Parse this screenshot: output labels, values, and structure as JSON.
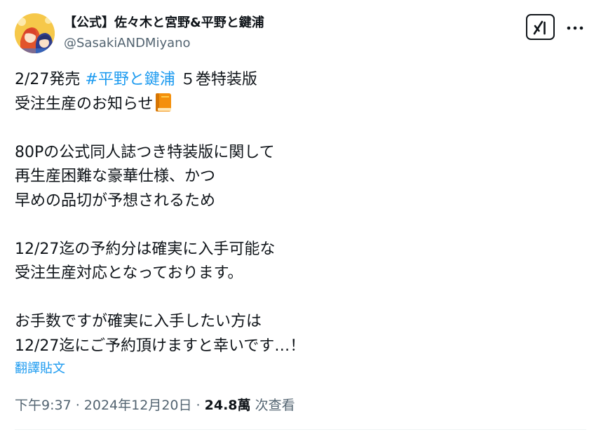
{
  "author": {
    "display_name": "【公式】佐々木と宮野&平野と鍵浦",
    "handle": "@SasakiANDMiyano",
    "avatar_icon": "anime-characters-avatar-icon"
  },
  "header_actions": {
    "grok_icon": "grok-icon",
    "more_icon": "more-horizontal-icon"
  },
  "post": {
    "line1_prefix": "2/27発売 ",
    "line1_hashtag": "#平野と鍵浦",
    "line1_suffix": " ５巻特装版",
    "line2_text": "受注生産のお知らせ",
    "line2_emoji": "orange-book-emoji-icon",
    "line4": "80Pの公式同人誌つき特装版に関して",
    "line5": "再生産困難な豪華仕様、かつ",
    "line6": "早めの品切が予想されるため",
    "line8": "12/27迄の予約分は確実に入手可能な",
    "line9": "受注生産対応となっております。",
    "line11": "お手数ですが確実に入手したい方は",
    "line12": "12/27迄にご予約頂けますと幸いです…！"
  },
  "translate_label": "翻譯貼文",
  "meta": {
    "time": "下午9:37",
    "separator1": " · ",
    "date": "2024年12月20日",
    "separator2": " · ",
    "views_count": "24.8萬",
    "views_label": " 次查看"
  },
  "colors": {
    "text": "#0f1419",
    "secondary": "#536471",
    "link": "#1d9bf0",
    "divider": "#eff3f4"
  }
}
